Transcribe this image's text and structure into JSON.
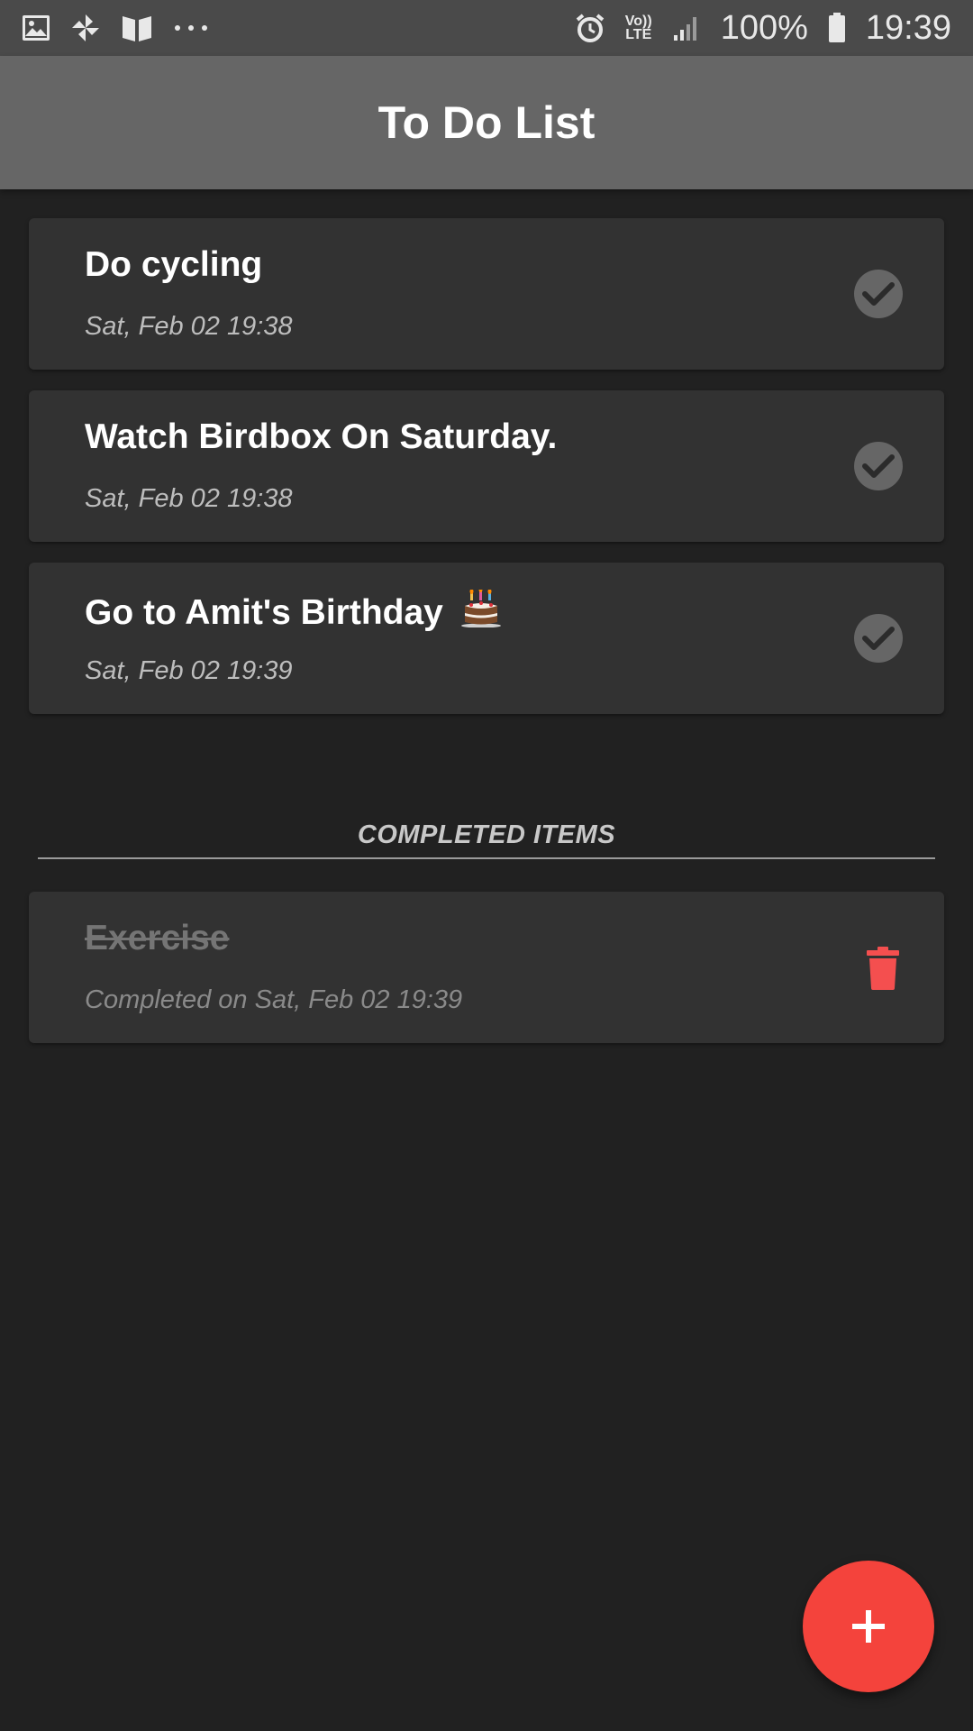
{
  "status_bar": {
    "left_icons": [
      "gallery-icon",
      "pinwheel-icon",
      "book-icon",
      "more-dots-icon"
    ],
    "volte_line1": "Vo))",
    "volte_line2": "LTE",
    "battery_percent": "100%",
    "time": "19:39"
  },
  "app_bar": {
    "title": "To Do List"
  },
  "todo_items": [
    {
      "title": "Do cycling",
      "date": "Sat, Feb 02 19:38"
    },
    {
      "title": "Watch Birdbox On Saturday.",
      "date": "Sat, Feb 02 19:38"
    },
    {
      "title": "Go to Amit's Birthday",
      "date": "Sat, Feb 02 19:39",
      "emoji": "birthday-cake-icon"
    }
  ],
  "completed_section": {
    "header": "COMPLETED ITEMS",
    "items": [
      {
        "title": "Exercise",
        "date": "Completed on Sat, Feb 02 19:39"
      }
    ]
  },
  "colors": {
    "background": "#212121",
    "card": "#323232",
    "app_bar": "#666666",
    "accent_red": "#f4433c"
  },
  "fab": {
    "icon": "plus-icon"
  }
}
